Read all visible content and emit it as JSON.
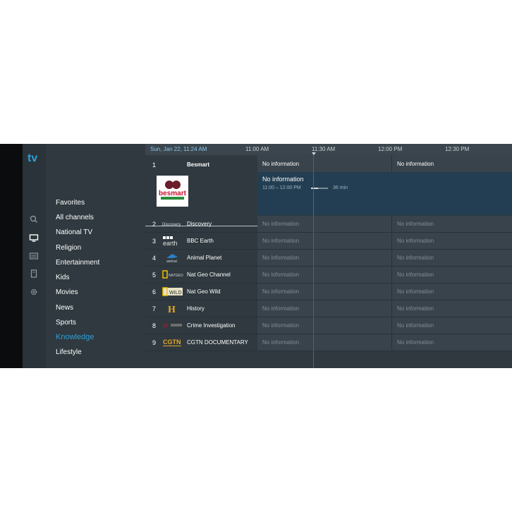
{
  "brand": {
    "logo_text": "tv",
    "color": "#2d9fd8"
  },
  "rail_icons": [
    "search-icon",
    "tv-icon",
    "guide-icon",
    "bookmark-icon",
    "gear-icon"
  ],
  "categories": [
    {
      "label": "Favorites",
      "active": false
    },
    {
      "label": "All channels",
      "active": false
    },
    {
      "label": "National TV",
      "active": false
    },
    {
      "label": "Religion",
      "active": false
    },
    {
      "label": "Entertainment",
      "active": false
    },
    {
      "label": "Kids",
      "active": false
    },
    {
      "label": "Movies",
      "active": false
    },
    {
      "label": "News",
      "active": false
    },
    {
      "label": "Sports",
      "active": false
    },
    {
      "label": "Knowledge",
      "active": true
    },
    {
      "label": "Lifestyle",
      "active": false
    }
  ],
  "timebar": {
    "current": "Sun, Jan 22, 11:24 AM",
    "slots": [
      "11:00 AM",
      "11:30 AM",
      "12:00 PM",
      "12:30 PM"
    ]
  },
  "selected_channel": {
    "number": "1",
    "name": "Besmart",
    "logo_text": "besmart",
    "programs": [
      "No information",
      "No information"
    ],
    "detail": {
      "title": "No information",
      "time": "11:00 – 12:00 PM",
      "duration": "36 min",
      "progress": 0.4
    }
  },
  "channels": [
    {
      "number": "2",
      "name": "Discovery",
      "logo_text": "Discovery",
      "programs": [
        "No information",
        "No information"
      ]
    },
    {
      "number": "3",
      "name": "BBC Earth",
      "logo_text": "earth",
      "programs": [
        "No information",
        "No information"
      ]
    },
    {
      "number": "4",
      "name": "Animal Planet",
      "logo_text": "animal",
      "programs": [
        "No information",
        "No information"
      ]
    },
    {
      "number": "5",
      "name": "Nat Geo Channel",
      "logo_text": "NATGEO",
      "programs": [
        "No information",
        "No information"
      ]
    },
    {
      "number": "6",
      "name": "Nat Geo Wild",
      "logo_text": "WILD",
      "programs": [
        "No information",
        "No information"
      ]
    },
    {
      "number": "7",
      "name": "History",
      "logo_text": "H",
      "programs": [
        "No information",
        "No information"
      ]
    },
    {
      "number": "8",
      "name": "Crime Investigation",
      "logo_text": "CI",
      "programs": [
        "No information",
        "No information"
      ]
    },
    {
      "number": "9",
      "name": "CGTN DOCUMENTARY",
      "logo_text": "CGTN",
      "programs": [
        "No information",
        "No information"
      ]
    }
  ]
}
